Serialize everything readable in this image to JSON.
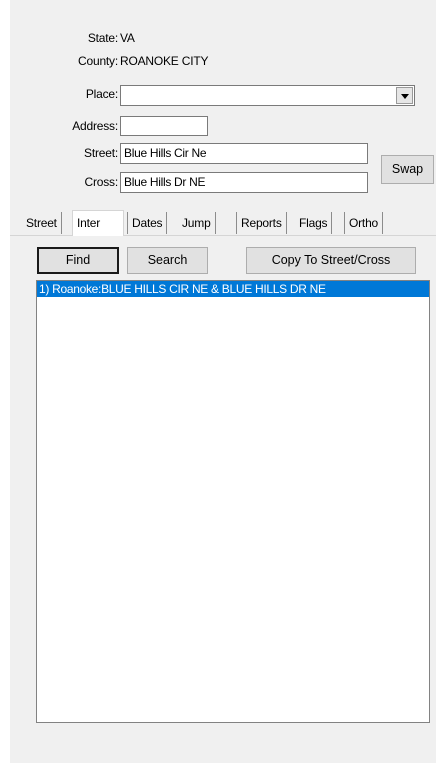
{
  "location": {
    "state_label": "State:",
    "state_value": "VA",
    "county_label": "County:",
    "county_value": "ROANOKE CITY",
    "place_label": "Place:",
    "place_value": "",
    "address_label": "Address:",
    "address_value": "",
    "street_label": "Street:",
    "street_value": "Blue Hills Cir Ne",
    "cross_label": "Cross:",
    "cross_value": "Blue Hills Dr NE",
    "swap_label": "Swap"
  },
  "tabs": [
    {
      "label": "Street"
    },
    {
      "label": "Inter"
    },
    {
      "label": "Dates"
    },
    {
      "label": "Jump"
    },
    {
      "label": "Reports"
    },
    {
      "label": "Flags"
    },
    {
      "label": "Ortho"
    }
  ],
  "inter": {
    "find_label": "Find",
    "search_label": "Search",
    "copy_label": "Copy To Street/Cross",
    "results": [
      {
        "text": "1) Roanoke:BLUE HILLS CIR NE & BLUE HILLS DR NE",
        "selected": true
      }
    ]
  },
  "colors": {
    "selection": "#0078d7",
    "panel_bg": "#f0f0f0"
  }
}
